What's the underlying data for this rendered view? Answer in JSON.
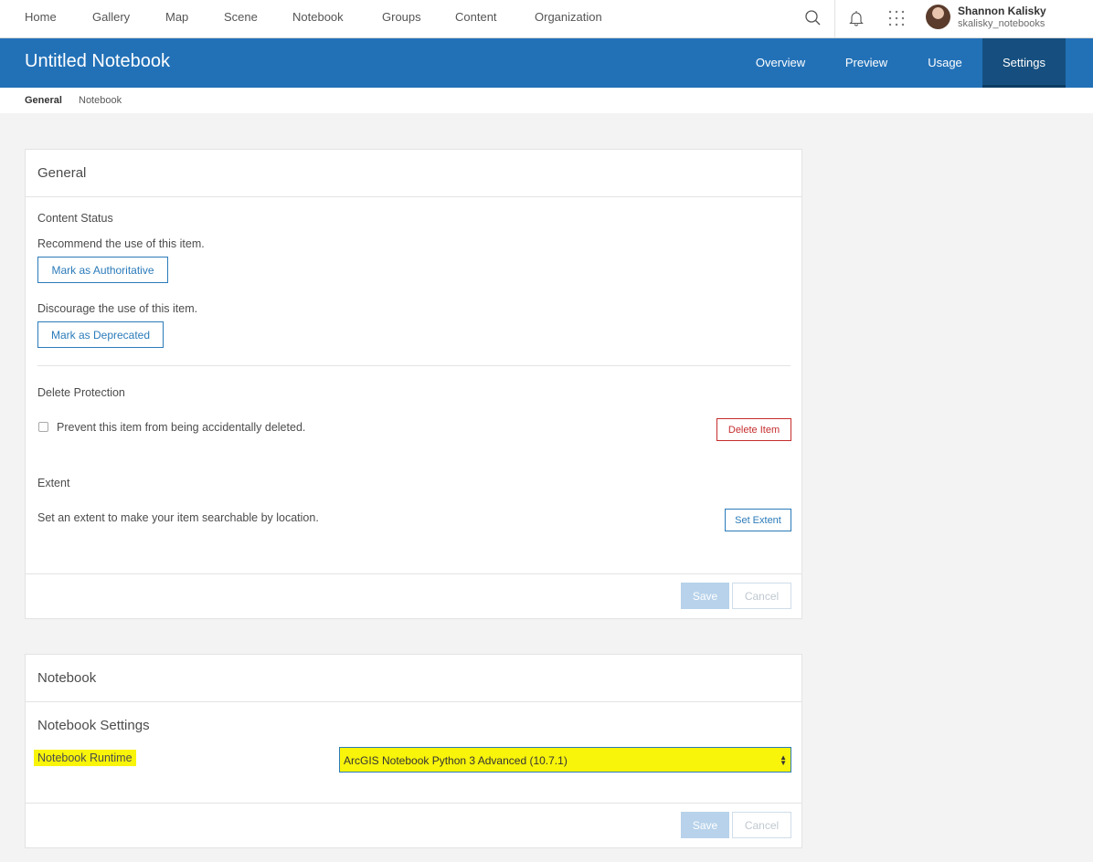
{
  "topnav": {
    "links": [
      "Home",
      "Gallery",
      "Map",
      "Scene",
      "Notebook",
      "Groups",
      "Content",
      "Organization"
    ],
    "icons": [
      "search-icon",
      "bell-icon",
      "apps-grid-icon"
    ],
    "user": {
      "name": "Shannon Kalisky",
      "username": "skalisky_notebooks"
    }
  },
  "header": {
    "title": "Untitled Notebook",
    "tabs": [
      "Overview",
      "Preview",
      "Usage",
      "Settings"
    ],
    "active_tab": "Settings"
  },
  "subnav": {
    "items": [
      "General",
      "Notebook"
    ],
    "active": "General"
  },
  "general": {
    "heading": "General",
    "content_status": {
      "heading": "Content Status",
      "recommend_text": "Recommend the use of this item.",
      "authoritative_button": "Mark as Authoritative",
      "discourage_text": "Discourage the use of this item.",
      "deprecated_button": "Mark as Deprecated"
    },
    "delete_protection": {
      "heading": "Delete Protection",
      "checkbox_label": "Prevent this item from being accidentally deleted.",
      "checked": false,
      "delete_button": "Delete Item"
    },
    "extent": {
      "heading": "Extent",
      "text": "Set an extent to make your item searchable by location.",
      "button": "Set Extent"
    },
    "save": "Save",
    "cancel": "Cancel"
  },
  "notebook": {
    "heading": "Notebook",
    "settings_heading": "Notebook Settings",
    "runtime_label": "Notebook Runtime",
    "runtime_value": "ArcGIS Notebook Python 3 Advanced (10.7.1)",
    "highlight_color": "#f8f40a",
    "save": "Save",
    "cancel": "Cancel"
  },
  "colors": {
    "brand_blue": "#2271b7",
    "active_tab": "#164f7f",
    "danger": "#c62d2d"
  }
}
